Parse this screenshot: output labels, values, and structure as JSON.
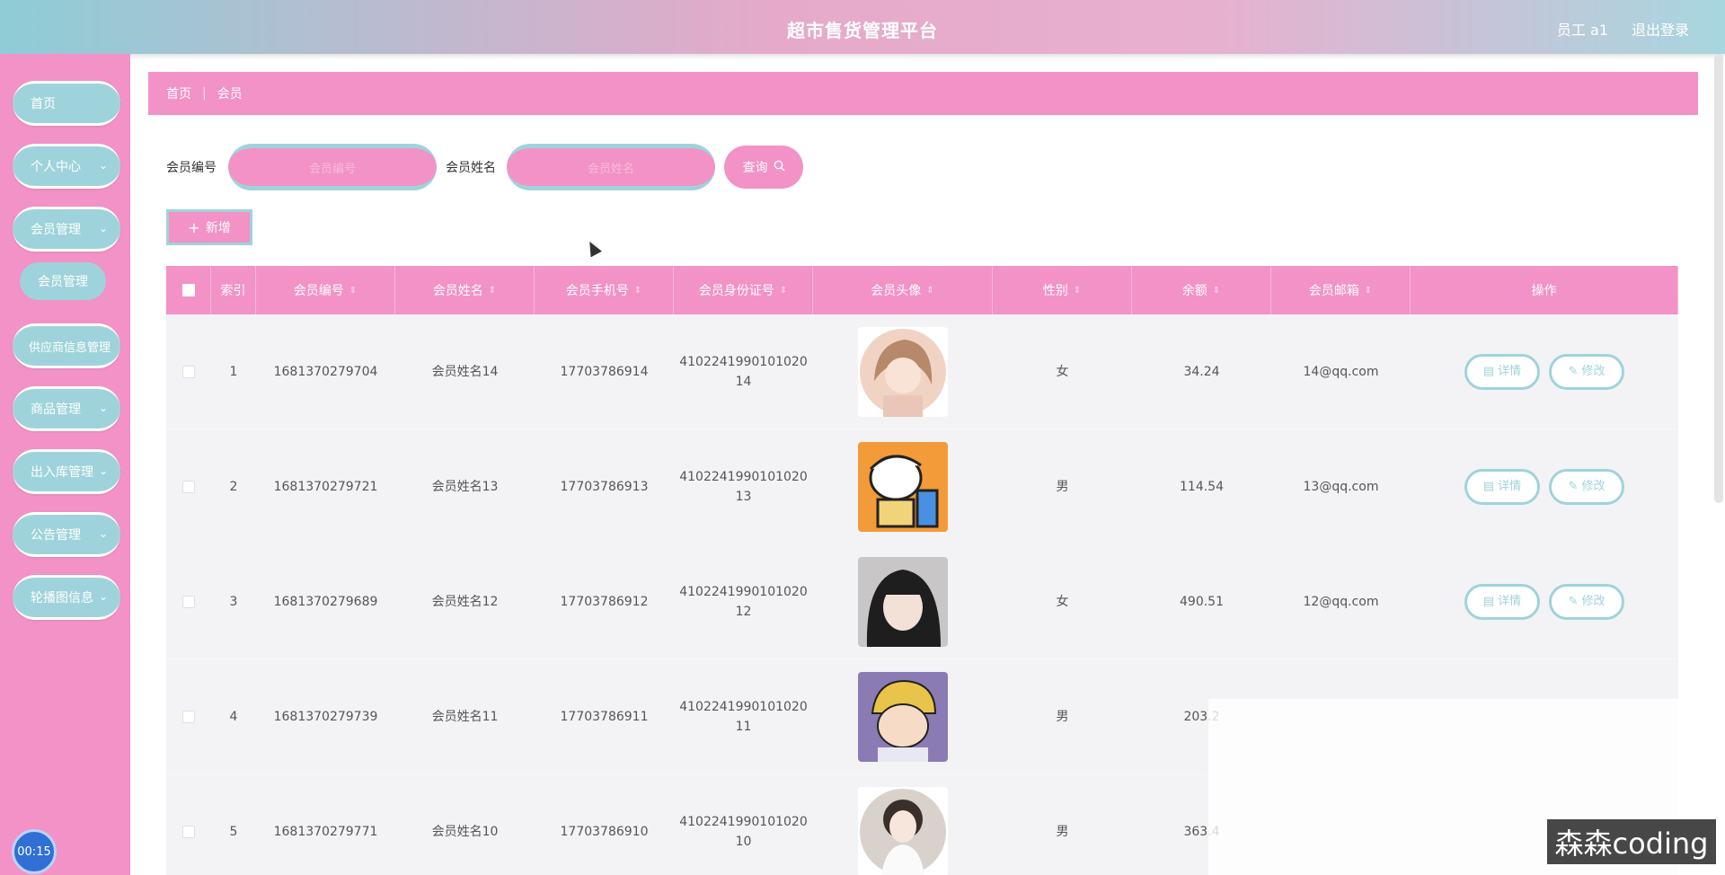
{
  "header": {
    "title": "超市售货管理平台",
    "user": "员工 a1",
    "logout": "退出登录"
  },
  "sidebar": {
    "items": [
      {
        "label": "首页",
        "has_arrow": false
      },
      {
        "label": "个人中心",
        "has_arrow": true
      },
      {
        "label": "会员管理",
        "has_arrow": true
      },
      {
        "label": "会员管理",
        "sub": true
      },
      {
        "label": "供应商信息管理",
        "has_arrow": false
      },
      {
        "label": "商品管理",
        "has_arrow": true
      },
      {
        "label": "出入库管理",
        "has_arrow": true
      },
      {
        "label": "公告管理",
        "has_arrow": true
      },
      {
        "label": "轮播图信息",
        "has_arrow": true
      }
    ],
    "timer": "00:15"
  },
  "breadcrumb": {
    "home": "首页",
    "current": "会员"
  },
  "search": {
    "member_no_label": "会员编号",
    "member_no_placeholder": "会员编号",
    "member_name_label": "会员姓名",
    "member_name_placeholder": "会员姓名",
    "query_button": "查询"
  },
  "add_button": "新增",
  "table": {
    "headers": [
      "索引",
      "会员编号",
      "会员姓名",
      "会员手机号",
      "会员身份证号",
      "会员头像",
      "性别",
      "余额",
      "会员邮箱",
      "操作"
    ],
    "rows": [
      {
        "index": "1",
        "no": "1681370279704",
        "name": "会员姓名14",
        "phone": "17703786914",
        "id": "410224199010102014",
        "gender": "女",
        "balance": "34.24",
        "email": "14@qq.com",
        "avatar_color": "#f1d3c4"
      },
      {
        "index": "2",
        "no": "1681370279721",
        "name": "会员姓名13",
        "phone": "17703786913",
        "id": "410224199010102013",
        "gender": "男",
        "balance": "114.54",
        "email": "13@qq.com",
        "avatar_color": "#f29b38"
      },
      {
        "index": "3",
        "no": "1681370279689",
        "name": "会员姓名12",
        "phone": "17703786912",
        "id": "410224199010102012",
        "gender": "女",
        "balance": "490.51",
        "email": "12@qq.com",
        "avatar_color": "#2b2b2b"
      },
      {
        "index": "4",
        "no": "1681370279739",
        "name": "会员姓名11",
        "phone": "17703786911",
        "id": "410224199010102011",
        "gender": "男",
        "balance": "203.2",
        "email": "",
        "avatar_color": "#e9c44a"
      },
      {
        "index": "5",
        "no": "1681370279771",
        "name": "会员姓名10",
        "phone": "17703786910",
        "id": "410224199010102010",
        "gender": "男",
        "balance": "363.4",
        "email": "",
        "avatar_color": "#d9d2cc"
      }
    ],
    "detail_label": "详情",
    "edit_label": "修改"
  },
  "watermark": "森森coding",
  "colors": {
    "primary_pink": "#f292c6",
    "accent_teal": "#9fd3db"
  }
}
